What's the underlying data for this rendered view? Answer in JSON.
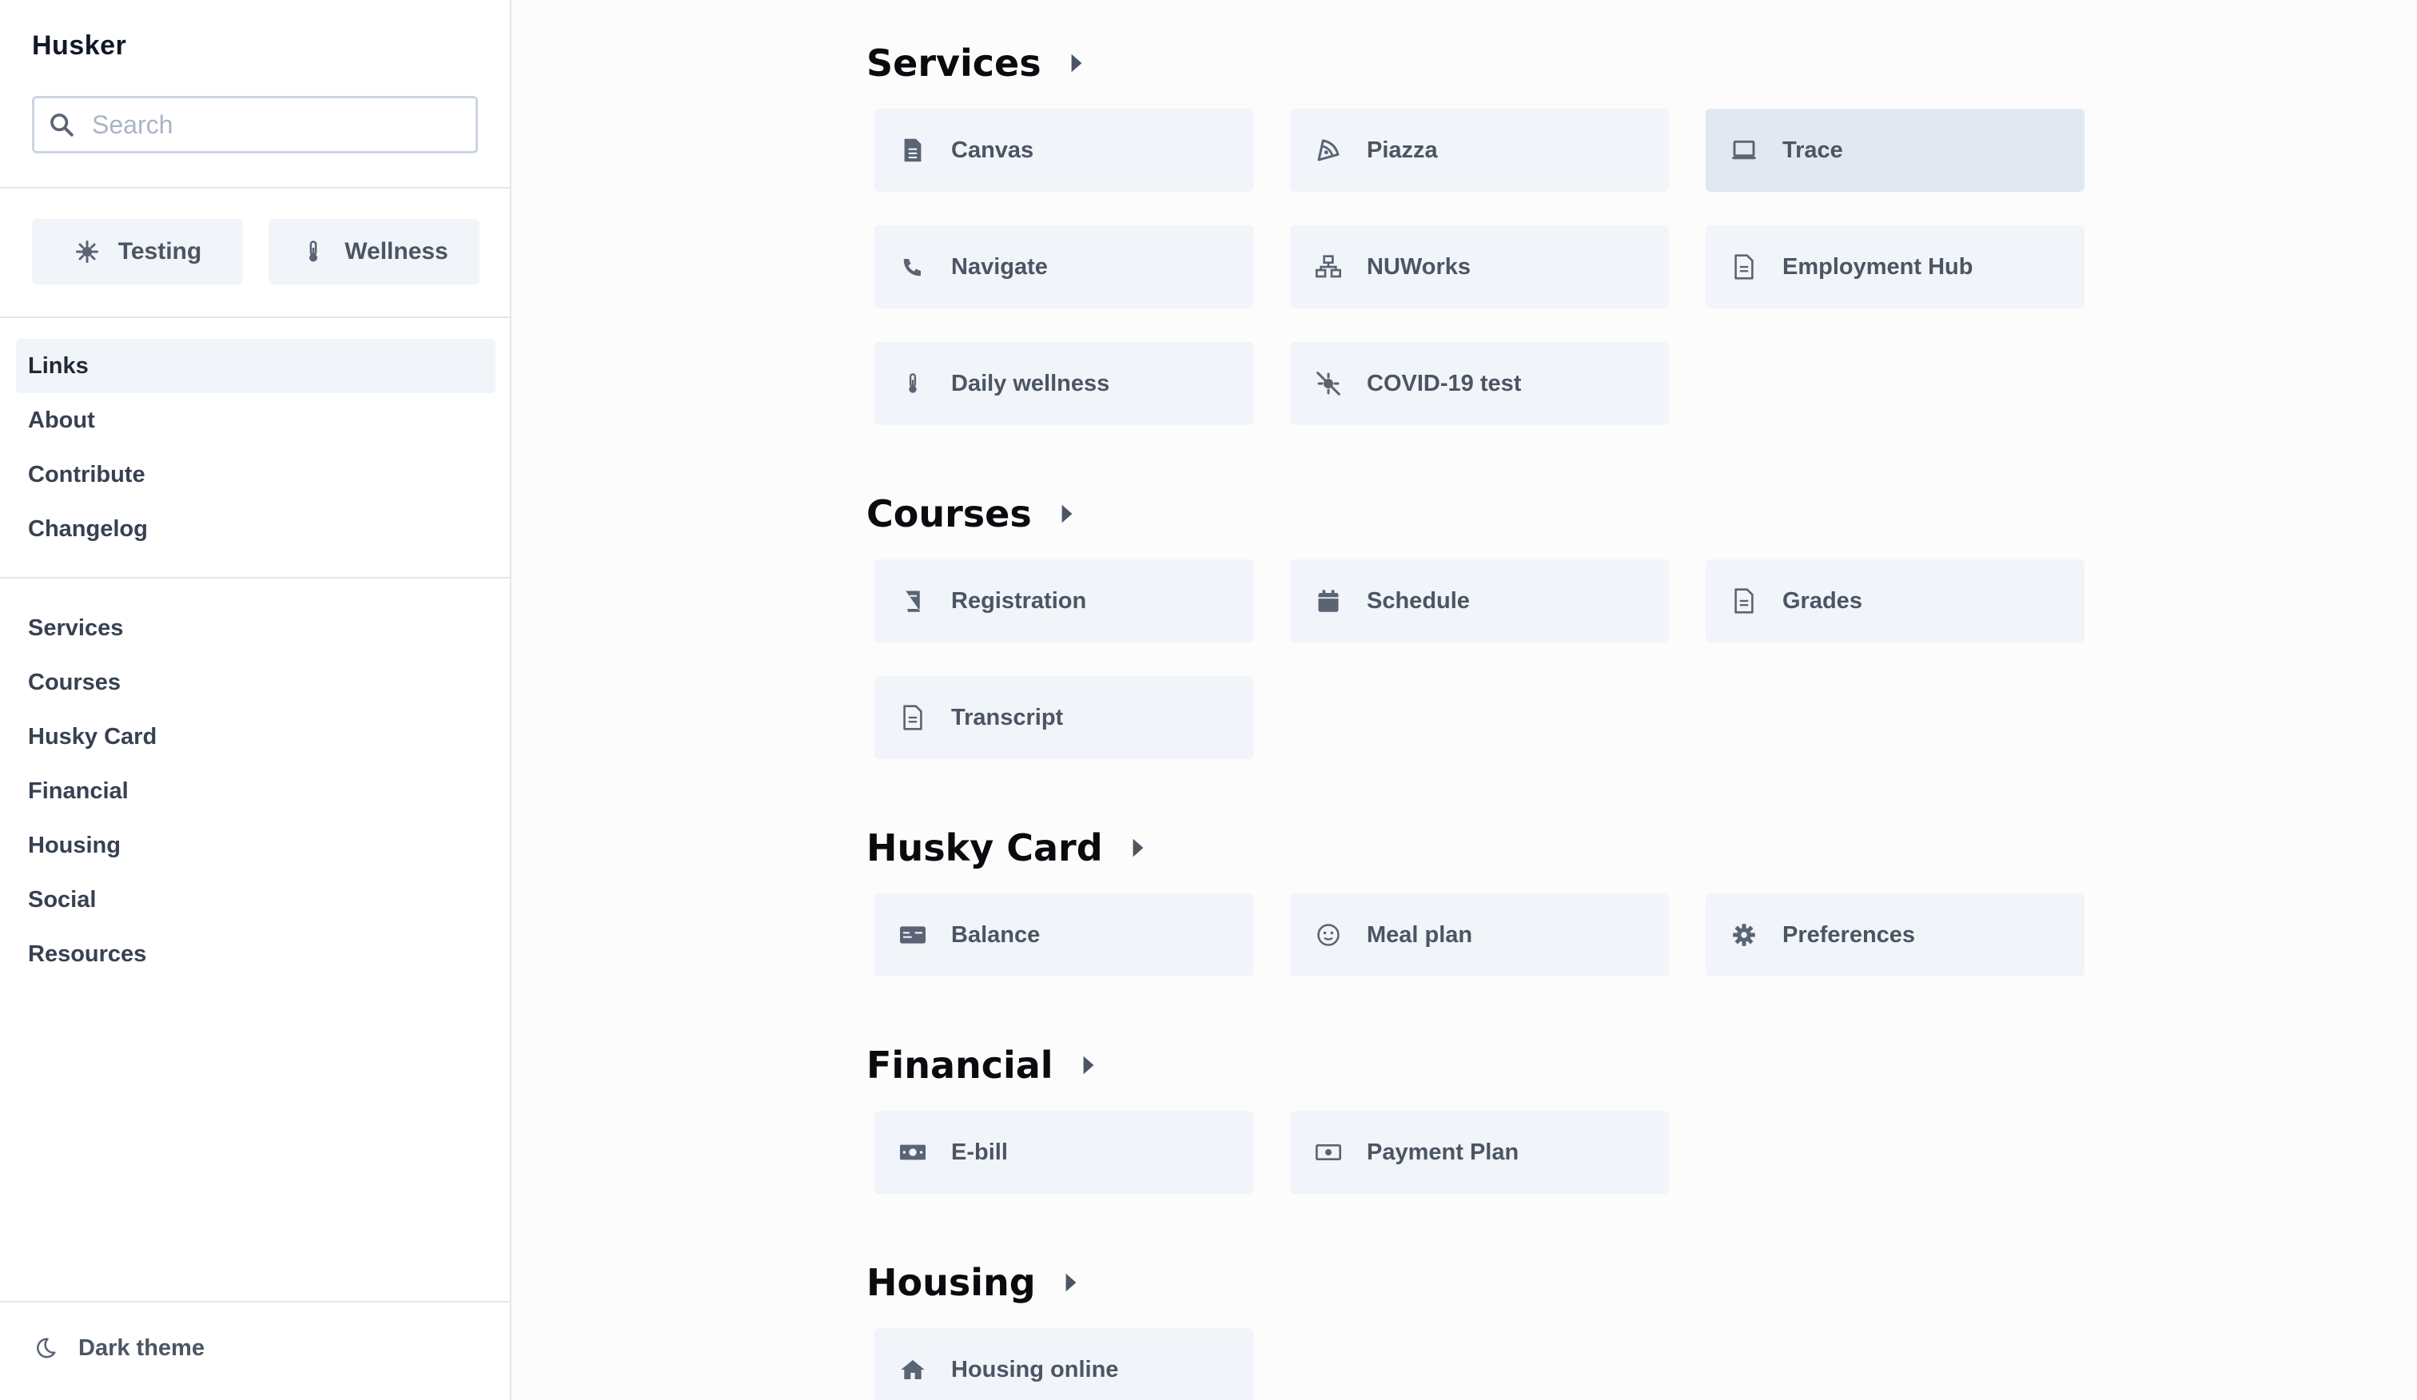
{
  "sidebar": {
    "brand": "Husker",
    "search_placeholder": "Search",
    "quick": [
      {
        "label": "Testing",
        "icon": "virus-icon"
      },
      {
        "label": "Wellness",
        "icon": "thermometer-icon"
      }
    ],
    "primary_nav": [
      "Links",
      "About",
      "Contribute",
      "Changelog"
    ],
    "active": "Links",
    "section_nav": [
      "Services",
      "Courses",
      "Husky Card",
      "Financial",
      "Housing",
      "Social",
      "Resources"
    ],
    "theme_toggle": "Dark theme"
  },
  "sections": [
    {
      "title": "Services",
      "links": [
        {
          "label": "Canvas",
          "icon": "document-icon"
        },
        {
          "label": "Piazza",
          "icon": "piazza-icon"
        },
        {
          "label": "Trace",
          "icon": "laptop-icon"
        },
        {
          "label": "Navigate",
          "icon": "phone-icon"
        },
        {
          "label": "NUWorks",
          "icon": "network-icon"
        },
        {
          "label": "Employment Hub",
          "icon": "document-icon"
        },
        {
          "label": "Daily wellness",
          "icon": "thermometer-icon"
        },
        {
          "label": "COVID-19 test",
          "icon": "virus-slash-icon"
        }
      ]
    },
    {
      "title": "Courses",
      "links": [
        {
          "label": "Registration",
          "icon": "book-icon"
        },
        {
          "label": "Schedule",
          "icon": "calendar-icon"
        },
        {
          "label": "Grades",
          "icon": "document-icon"
        },
        {
          "label": "Transcript",
          "icon": "document-icon"
        }
      ]
    },
    {
      "title": "Husky Card",
      "links": [
        {
          "label": "Balance",
          "icon": "id-card-icon"
        },
        {
          "label": "Meal plan",
          "icon": "smile-icon"
        },
        {
          "label": "Preferences",
          "icon": "gear-icon"
        }
      ]
    },
    {
      "title": "Financial",
      "links": [
        {
          "label": "E-bill",
          "icon": "money-bill-icon"
        },
        {
          "label": "Payment Plan",
          "icon": "money-bill-outline-icon"
        }
      ]
    },
    {
      "title": "Housing",
      "links": [
        {
          "label": "Housing online",
          "icon": "home-icon"
        }
      ]
    }
  ],
  "colors": {
    "card_bg": "#f1f4f8",
    "card_hover_bg": "#e2e8f0",
    "icon": "#5b6474"
  }
}
